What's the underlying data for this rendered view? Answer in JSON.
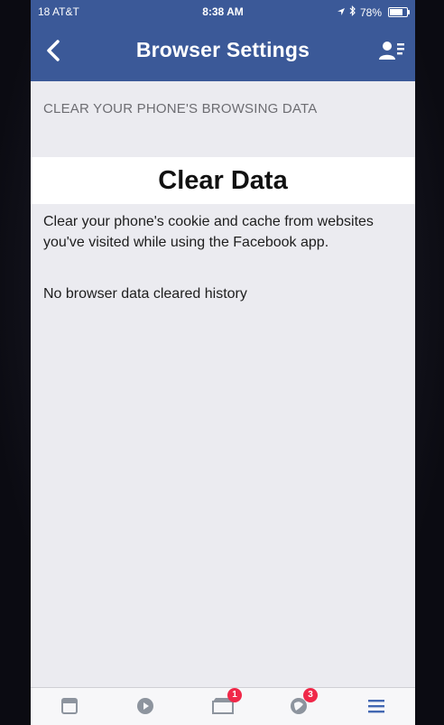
{
  "status_bar": {
    "carrier": "18 AT&T",
    "time": "8:38 AM",
    "battery": "78%",
    "battery_level": 0.78
  },
  "nav": {
    "title": "Browser Settings",
    "back_icon": "chevron-left-icon",
    "profile_icon": "contact-card-icon"
  },
  "content": {
    "section_header": "CLEAR YOUR PHONE'S BROWSING DATA",
    "clear_button_label": "Clear Data",
    "description": "Clear your phone's cookie and cache from websites you've visited while using the Facebook app.",
    "history_status": "No browser data cleared history"
  },
  "tab_bar": {
    "tabs": [
      {
        "icon": "news-feed-icon",
        "badge": ""
      },
      {
        "icon": "video-icon",
        "badge": ""
      },
      {
        "icon": "marketplace-icon",
        "badge": "1"
      },
      {
        "icon": "notifications-icon",
        "badge": "3"
      },
      {
        "icon": "menu-icon",
        "badge": ""
      }
    ]
  },
  "colors": {
    "facebook_blue": "#3b5998",
    "background": "#ebebf0",
    "badge_red": "#f02849"
  }
}
